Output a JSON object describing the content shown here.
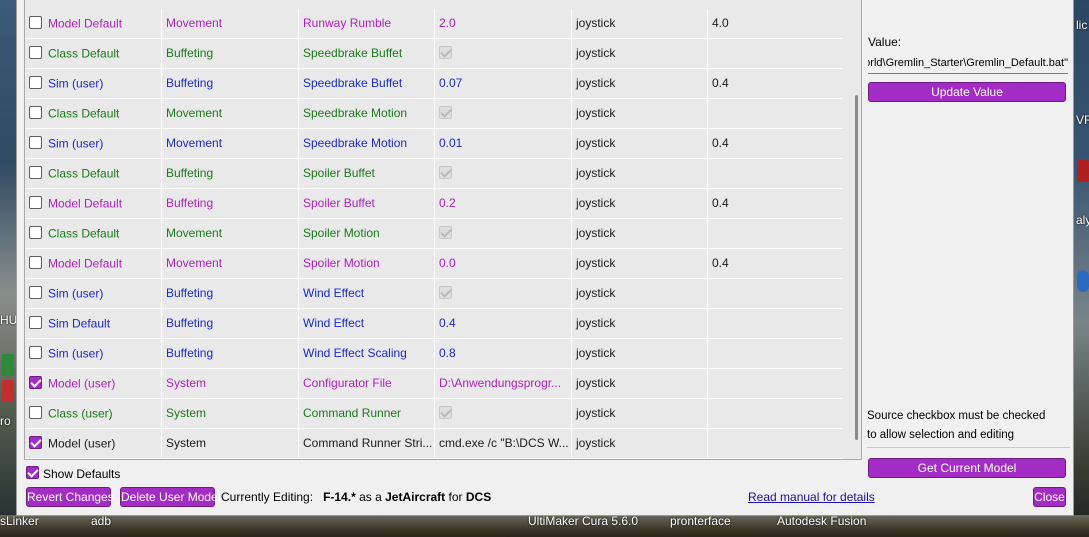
{
  "desktop": {
    "taskbar_labels": [
      "sLinker",
      "adb",
      "UltiMaker Cura 5.6.0",
      "pronterface",
      "Autodesk Fusion"
    ],
    "left_fragments": [
      "HU",
      "ro"
    ],
    "right_fragments": [
      "lic",
      "VR",
      "aly"
    ]
  },
  "table": {
    "rows": [
      {
        "checked": false,
        "type": "model",
        "source": "Model Default",
        "category": "Movement",
        "name": "Runway Rumble",
        "value": "2.0",
        "value_is_check": false,
        "device": "joystick",
        "extra": "4.0"
      },
      {
        "checked": false,
        "type": "class",
        "source": "Class Default",
        "category": "Buffeting",
        "name": "Speedbrake Buffet",
        "value": "",
        "value_is_check": true,
        "device": "joystick",
        "extra": ""
      },
      {
        "checked": false,
        "type": "sim",
        "source": "Sim (user)",
        "category": "Buffeting",
        "name": "Speedbrake Buffet",
        "value": "0.07",
        "value_is_check": false,
        "device": "joystick",
        "extra": "0.4"
      },
      {
        "checked": false,
        "type": "class",
        "source": "Class Default",
        "category": "Movement",
        "name": "Speedbrake Motion",
        "value": "",
        "value_is_check": true,
        "device": "joystick",
        "extra": ""
      },
      {
        "checked": false,
        "type": "sim",
        "source": "Sim (user)",
        "category": "Movement",
        "name": "Speedbrake Motion",
        "value": "0.01",
        "value_is_check": false,
        "device": "joystick",
        "extra": "0.4"
      },
      {
        "checked": false,
        "type": "class",
        "source": "Class Default",
        "category": "Buffeting",
        "name": "Spoiler Buffet",
        "value": "",
        "value_is_check": true,
        "device": "joystick",
        "extra": ""
      },
      {
        "checked": false,
        "type": "model",
        "source": "Model Default",
        "category": "Buffeting",
        "name": "Spoiler Buffet",
        "value": "0.2",
        "value_is_check": false,
        "device": "joystick",
        "extra": "0.4"
      },
      {
        "checked": false,
        "type": "class",
        "source": "Class Default",
        "category": "Movement",
        "name": "Spoiler Motion",
        "value": "",
        "value_is_check": true,
        "device": "joystick",
        "extra": ""
      },
      {
        "checked": false,
        "type": "model",
        "source": "Model Default",
        "category": "Movement",
        "name": "Spoiler Motion",
        "value": "0.0",
        "value_is_check": false,
        "device": "joystick",
        "extra": "0.4"
      },
      {
        "checked": false,
        "type": "sim",
        "source": "Sim (user)",
        "category": "Buffeting",
        "name": "Wind Effect",
        "value": "",
        "value_is_check": true,
        "device": "joystick",
        "extra": ""
      },
      {
        "checked": false,
        "type": "sim",
        "source": "Sim Default",
        "category": "Buffeting",
        "name": "Wind Effect",
        "value": "0.4",
        "value_is_check": false,
        "device": "joystick",
        "extra": ""
      },
      {
        "checked": false,
        "type": "sim",
        "source": "Sim (user)",
        "category": "Buffeting",
        "name": "Wind Effect Scaling",
        "value": "0.8",
        "value_is_check": false,
        "device": "joystick",
        "extra": ""
      },
      {
        "checked": true,
        "type": "model",
        "source": "Model (user)",
        "category": "System",
        "name": "Configurator File",
        "value": "D:\\Anwendungsprogr...",
        "value_is_check": false,
        "device": "joystick",
        "extra": ""
      },
      {
        "checked": false,
        "type": "class",
        "source": "Class (user)",
        "category": "System",
        "name": "Command Runner",
        "value": "",
        "value_is_check": true,
        "device": "joystick",
        "extra": ""
      },
      {
        "checked": true,
        "type": "black",
        "source": "Model (user)",
        "category": "System",
        "name": "Command Runner Stri...",
        "value": "cmd.exe /c \"B:\\DCS W...",
        "value_is_check": false,
        "device": "joystick",
        "extra": ""
      }
    ]
  },
  "show_defaults": {
    "label": "Show Defaults",
    "checked": true
  },
  "buttons": {
    "revert": "Revert Changes",
    "delete": "Delete User Model",
    "update": "Update Value",
    "get_model": "Get Current Model",
    "close": "Close"
  },
  "status": {
    "prefix": "Currently Editing:",
    "model": "F-14.*",
    "as_a": "as a",
    "class": "JetAircraft",
    "for": "for",
    "sim": "DCS"
  },
  "manual_link": "Read manual for details",
  "value_panel": {
    "label": "Value:",
    "value": "c:\\Users\\FlightSim\\Saved Games\\Gremlin_World\\Gremlin_Starter\\Gremlin_Default.bat\"",
    "visible_text": "orld\\Gremlin_Starter\\Gremlin_Default.bat\""
  },
  "note": {
    "line1": "Source checkbox must be checked",
    "line2": "to allow selection and editing"
  },
  "colors": {
    "accent": "#a32cc4",
    "model": "#b020c0",
    "class": "#1a7a1a",
    "sim": "#1a2ad0"
  }
}
